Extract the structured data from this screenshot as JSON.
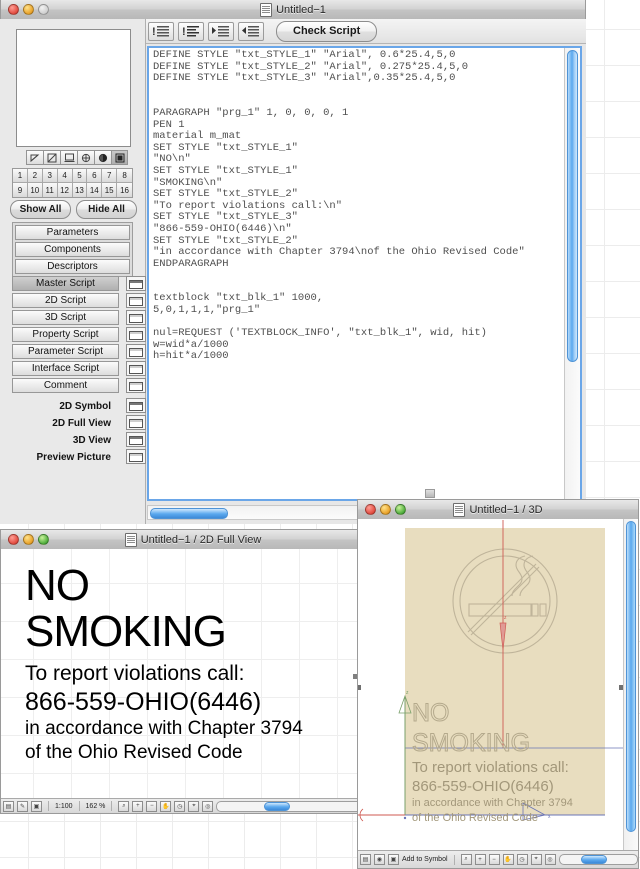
{
  "app": {
    "script_window_title": "Untitled−1",
    "full_view_window_title": "Untitled−1 / 2D Full View",
    "three_d_window_title": "Untitled−1 / 3D"
  },
  "toolbar": {
    "buttons": [
      {
        "name": "comment-out-lines-icon",
        "label": ""
      },
      {
        "name": "uncomment-lines-icon",
        "label": ""
      },
      {
        "name": "indent-right-icon",
        "label": ""
      },
      {
        "name": "indent-left-icon",
        "label": ""
      }
    ],
    "check_script_label": "Check Script"
  },
  "editor": {
    "code": "DEFINE STYLE \"txt_STYLE_1\" \"Arial\", 0.6*25.4,5,0\nDEFINE STYLE \"txt_STYLE_2\" \"Arial\", 0.275*25.4,5,0\nDEFINE STYLE \"txt_STYLE_3\" \"Arial\",0.35*25.4,5,0\n\n\nPARAGRAPH \"prg_1\" 1, 0, 0, 0, 1\nPEN 1\nmaterial m_mat\nSET STYLE \"txt_STYLE_1\"\n\"NO\\n\"\nSET STYLE \"txt_STYLE_1\"\n\"SMOKING\\n\"\nSET STYLE \"txt_STYLE_2\"\n\"To report violations call:\\n\"\nSET STYLE \"txt_STYLE_3\"\n\"866-559-OHIO(6446)\\n\"\nSET STYLE \"txt_STYLE_2\"\n\"in accordance with Chapter 3794\\nof the Ohio Revised Code\"\nENDPARAGRAPH\n\n\ntextblock \"txt_blk_1\" 1000,\n5,0,1,1,1,\"prg_1\"\n\nnul=REQUEST ('TEXTBLOCK_INFO', \"txt_blk_1\", wid, hit)\nw=wid*a/1000\nh=hit*a/1000"
  },
  "left_panel": {
    "layer_numbers": [
      "1",
      "2",
      "3",
      "4",
      "5",
      "6",
      "7",
      "8",
      "9",
      "10",
      "11",
      "12",
      "13",
      "14",
      "15",
      "16"
    ],
    "show_all_label": "Show All",
    "hide_all_label": "Hide All",
    "detail_buttons": [
      {
        "label": "Parameters"
      },
      {
        "label": "Components"
      },
      {
        "label": "Descriptors"
      }
    ],
    "script_items": [
      {
        "label": "Master Script",
        "selected": true
      },
      {
        "label": "2D Script",
        "selected": false
      },
      {
        "label": "3D Script",
        "selected": false
      },
      {
        "label": "Property Script",
        "selected": false
      },
      {
        "label": "Parameter Script",
        "selected": false
      },
      {
        "label": "Interface Script",
        "selected": false
      },
      {
        "label": "Comment",
        "selected": false
      }
    ],
    "view_items": [
      {
        "label": "2D Symbol"
      },
      {
        "label": "2D Full View"
      },
      {
        "label": "3D View"
      },
      {
        "label": "Preview Picture"
      }
    ]
  },
  "full_view": {
    "sign_lines": {
      "line1": "NO",
      "line2": "SMOKING",
      "line3": "To report violations call:",
      "line4": "866-559-OHIO(6446)",
      "line5": "in accordance with Chapter 3794",
      "line6": "of the Ohio Revised Code"
    },
    "status": {
      "scale": "1:100",
      "zoom": "162 %"
    }
  },
  "three_d": {
    "sign_lines": {
      "line1": "NO",
      "line2": "SMOKING",
      "line3": "To report violations call:",
      "line4": "866-559-OHIO(6446)",
      "line5": "in accordance with Chapter 3794",
      "line6": "of the Ohio Revised Code"
    },
    "status": {
      "add_to_symbol_label": "Add to Symbol"
    },
    "plate_color": "#e8ddbf",
    "outline_color": "#b4a98c"
  }
}
